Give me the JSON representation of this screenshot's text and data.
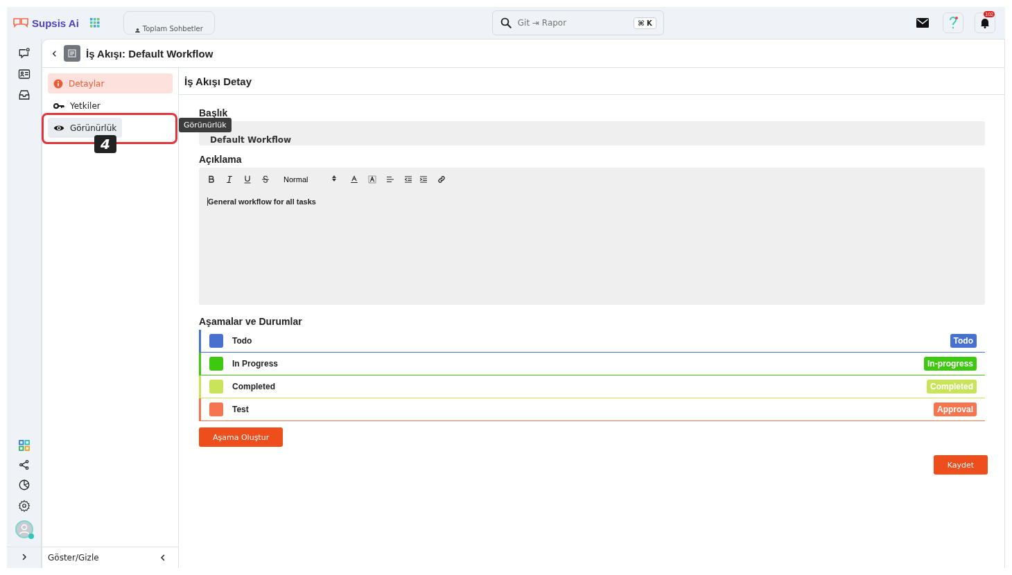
{
  "brand": {
    "name": "Supsis Ai"
  },
  "top_tab": {
    "label": "Toplam Sohbetler"
  },
  "search": {
    "placeholder": "Git ⇥ Rapor",
    "shortcut": "⌘ K"
  },
  "notifications": {
    "count": "102"
  },
  "page": {
    "title": "İş Akışı: Default Workflow"
  },
  "nav": [
    {
      "label": "Detaylar",
      "selected": true
    },
    {
      "label": "Yetkiler",
      "selected": false
    },
    {
      "label": "Görünürlük",
      "selected": false,
      "hovered": true
    }
  ],
  "tooltip": {
    "text": "Görünürlük"
  },
  "annotation": {
    "step": "4"
  },
  "nav_footer": {
    "label": "Göster/Gizle"
  },
  "section": {
    "title": "İş Akışı Detay"
  },
  "form": {
    "title_label": "Başlık",
    "title_value": "Default Workflow",
    "description_label": "Açıklama",
    "format": "Normal",
    "description": "General workflow for all tasks"
  },
  "stages": {
    "title": "Aşamalar ve Durumlar",
    "items": [
      {
        "name": "Todo",
        "status": "Todo",
        "color": "#4671cf"
      },
      {
        "name": "In Progress",
        "status": "In-progress",
        "color": "#3dc910"
      },
      {
        "name": "Completed",
        "status": "Completed",
        "color": "#c9e35a"
      },
      {
        "name": "Test",
        "status": "Approval",
        "color": "#f6754e"
      }
    ]
  },
  "buttons": {
    "create": "Aşama Oluştur",
    "save": "Kaydet"
  }
}
